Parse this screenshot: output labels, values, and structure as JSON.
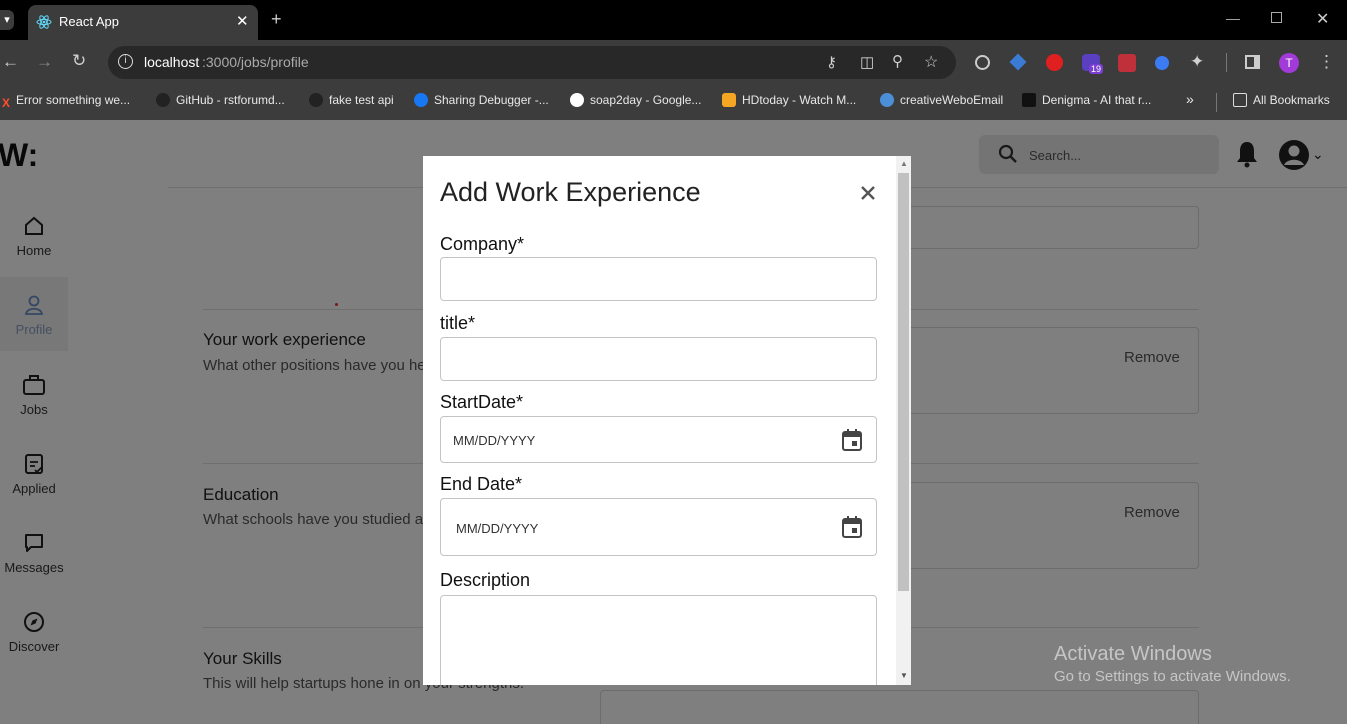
{
  "browser": {
    "tab_title": "React App",
    "url_host": "localhost",
    "url_rest": ":3000/jobs/profile",
    "profile_initial": "T",
    "extension_badge": "19"
  },
  "bookmarks": [
    "Error something we...",
    "GitHub - rstforumd...",
    "fake test api",
    "Sharing Debugger -...",
    "soap2day - Google...",
    "HDtoday - Watch M...",
    "creativeWeboEmail",
    "Denigma - AI that r...",
    "All Bookmarks"
  ],
  "header": {
    "logo": "W:",
    "search_placeholder": "Search..."
  },
  "nav": [
    {
      "label": "Home",
      "icon": "home-icon"
    },
    {
      "label": "Profile",
      "icon": "user-icon"
    },
    {
      "label": "Jobs",
      "icon": "briefcase-icon"
    },
    {
      "label": "Applied",
      "icon": "clipboard-check-icon"
    },
    {
      "label": "Messages",
      "icon": "message-icon"
    },
    {
      "label": "Discover",
      "icon": "compass-icon"
    }
  ],
  "sections": {
    "work": {
      "title": "Your work experience",
      "subtitle": "What other positions have you he"
    },
    "education": {
      "title": "Education",
      "subtitle": "What schools have you studied a"
    },
    "skills": {
      "title": "Your Skills",
      "subtitle": "This will help startups hone in on your strengths."
    },
    "remove_label": "Remove"
  },
  "modal": {
    "title": "Add Work Experience",
    "company_label": "Company*",
    "title_label": "title*",
    "start_label": "StartDate*",
    "start_placeholder": "MM/DD/YYYY",
    "end_label": "End Date*",
    "end_placeholder": "MM/DD/YYYY",
    "description_label": "Description"
  },
  "watermark": {
    "line1": "Activate Windows",
    "line2": "Go to Settings to activate Windows."
  }
}
